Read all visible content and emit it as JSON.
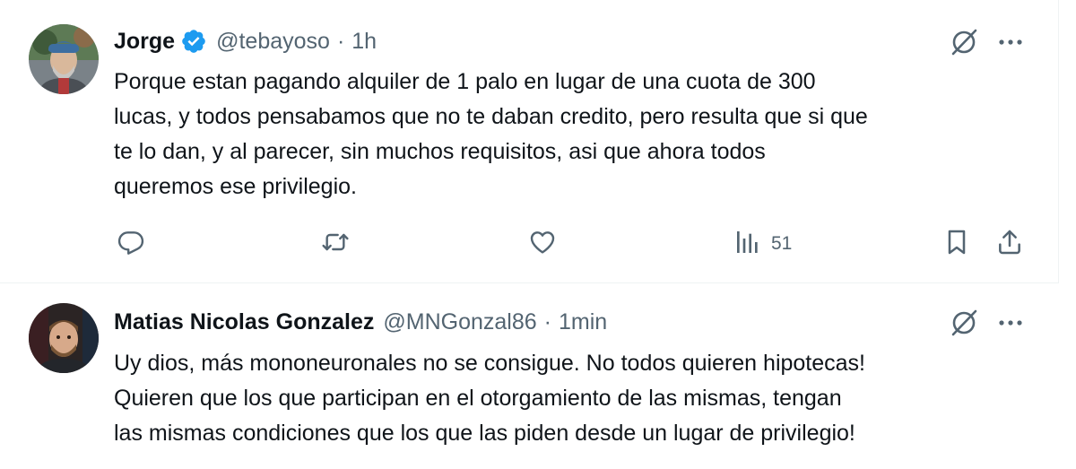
{
  "tweets": [
    {
      "name": "Jorge",
      "handle": "@tebayoso",
      "separator": "·",
      "time": "1h",
      "text": "Porque estan pagando alquiler de 1 palo en lugar de una cuota de 300\nlucas, y todos pensabamos que no te daban credito, pero resulta que si que\nte lo dan, y al parecer, sin muchos requisitos, asi que ahora todos\nqueremos ese privilegio.",
      "views": "51"
    },
    {
      "name": "Matias Nicolas Gonzalez",
      "handle": "@MNGonzal86",
      "separator": "·",
      "time": "1min",
      "text": "Uy dios, más mononeuronales no se consigue. No todos quieren hipotecas!\nQuieren que los que participan en el otorgamiento de las mismas, tengan\nlas mismas condiciones que los que las piden desde un lugar de privilegio!"
    }
  ],
  "colors": {
    "verified": "#1d9bf0",
    "muted": "#536471",
    "text": "#0f1419",
    "divider": "#eff3f4"
  },
  "icons": [
    "verified-badge-icon",
    "grok-icon",
    "more-icon",
    "reply-icon",
    "retweet-icon",
    "like-icon",
    "views-icon",
    "bookmark-icon",
    "share-icon"
  ]
}
